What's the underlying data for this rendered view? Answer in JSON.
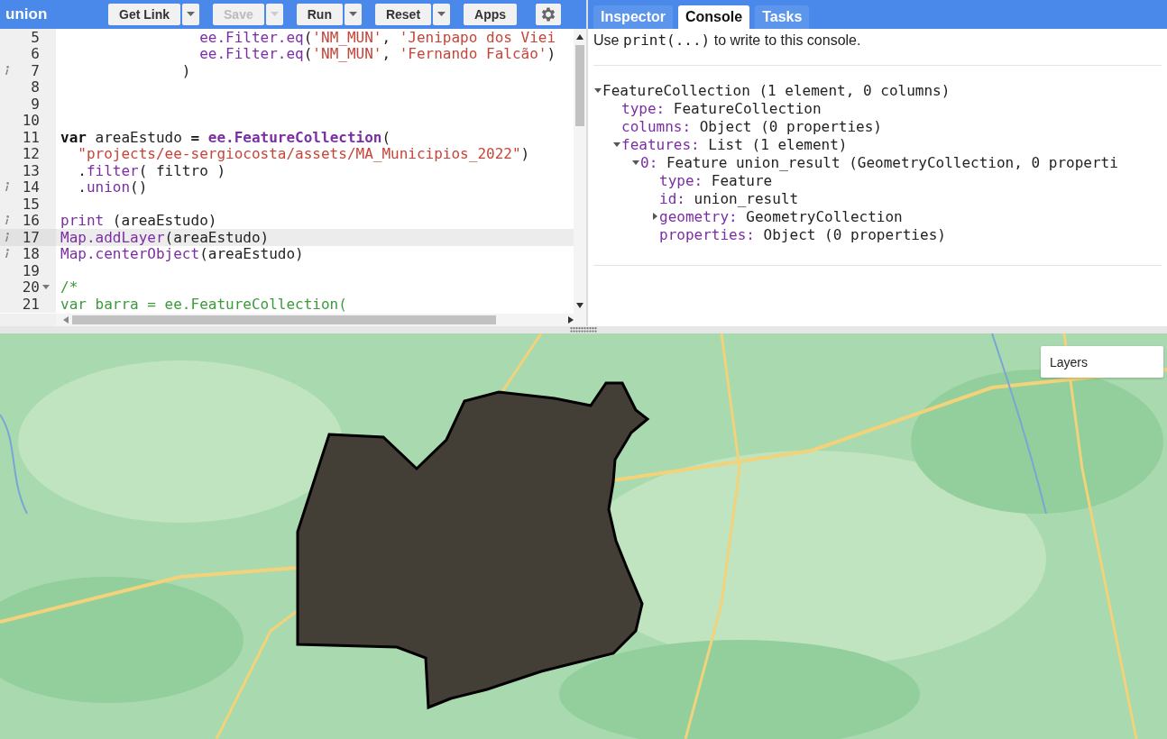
{
  "toolbar": {
    "title": "union",
    "buttons": [
      {
        "label": "Get Link",
        "has_menu": true,
        "disabled": false
      },
      {
        "label": "Save",
        "has_menu": true,
        "disabled": true
      },
      {
        "label": "Run",
        "has_menu": true,
        "disabled": false
      },
      {
        "label": "Reset",
        "has_menu": true,
        "disabled": false
      },
      {
        "label": "Apps",
        "has_menu": false,
        "disabled": false
      }
    ]
  },
  "editor": {
    "lines": [
      {
        "number": "5",
        "info": false,
        "selected": false,
        "fold": false,
        "tokens": [
          {
            "t": "                ee.Filter.eq",
            "kind": "fn"
          },
          {
            "t": "(",
            "kind": "plain"
          },
          {
            "t": "'NM_MUN'",
            "kind": "str"
          },
          {
            "t": ", ",
            "kind": "plain"
          },
          {
            "t": "'Jenipapo dos Viei",
            "kind": "str"
          }
        ]
      },
      {
        "number": "6",
        "info": false,
        "selected": false,
        "fold": false,
        "tokens": [
          {
            "t": "                ee.Filter.eq",
            "kind": "fn"
          },
          {
            "t": "(",
            "kind": "plain"
          },
          {
            "t": "'NM_MUN'",
            "kind": "str"
          },
          {
            "t": ", ",
            "kind": "plain"
          },
          {
            "t": "'Fernando Falcão'",
            "kind": "str"
          },
          {
            "t": ")",
            "kind": "plain"
          }
        ]
      },
      {
        "number": "7",
        "info": true,
        "selected": false,
        "fold": false,
        "tokens": [
          {
            "t": "              )",
            "kind": "plain"
          }
        ]
      },
      {
        "number": "8",
        "info": false,
        "selected": false,
        "fold": false
      },
      {
        "number": "9",
        "info": false,
        "selected": false,
        "fold": false
      },
      {
        "number": "10",
        "info": false,
        "selected": false,
        "fold": false
      },
      {
        "number": "11",
        "info": false,
        "selected": false,
        "fold": false,
        "tokens": [
          {
            "t": "var",
            "kind": "kw"
          },
          {
            "t": " areaEstudo ",
            "kind": "plain"
          },
          {
            "t": "=",
            "kind": "kw"
          },
          {
            "t": " ee.FeatureCollection",
            "kind": "fnb"
          },
          {
            "t": "(",
            "kind": "plain"
          }
        ]
      },
      {
        "number": "12",
        "info": false,
        "selected": false,
        "fold": false,
        "tokens": [
          {
            "t": "  \"projects/ee-sergiocosta/assets/MA_Municipios_2022\"",
            "kind": "str"
          },
          {
            "t": ")",
            "kind": "plain"
          }
        ]
      },
      {
        "number": "13",
        "info": false,
        "selected": false,
        "fold": false,
        "tokens": [
          {
            "t": "  .",
            "kind": "plain"
          },
          {
            "t": "filter",
            "kind": "fn"
          },
          {
            "t": "( filtro )",
            "kind": "plain"
          }
        ]
      },
      {
        "number": "14",
        "info": true,
        "selected": false,
        "fold": false,
        "tokens": [
          {
            "t": "  .",
            "kind": "plain"
          },
          {
            "t": "union",
            "kind": "fn"
          },
          {
            "t": "()",
            "kind": "plain"
          }
        ]
      },
      {
        "number": "15",
        "info": false,
        "selected": false,
        "fold": false
      },
      {
        "number": "16",
        "info": true,
        "selected": false,
        "fold": false,
        "tokens": [
          {
            "t": "print",
            "kind": "fn"
          },
          {
            "t": " (areaEstudo)",
            "kind": "plain"
          }
        ]
      },
      {
        "number": "17",
        "info": true,
        "selected": true,
        "fold": false,
        "tokens": [
          {
            "t": "Map.addLayer",
            "kind": "fn"
          },
          {
            "t": "(areaEstudo)",
            "kind": "plain"
          }
        ]
      },
      {
        "number": "18",
        "info": true,
        "selected": false,
        "fold": false,
        "tokens": [
          {
            "t": "Map.centerObject",
            "kind": "fn"
          },
          {
            "t": "(areaEstudo)",
            "kind": "plain"
          }
        ]
      },
      {
        "number": "19",
        "info": false,
        "selected": false,
        "fold": false
      },
      {
        "number": "20",
        "info": false,
        "selected": false,
        "fold": true,
        "tokens": [
          {
            "t": "/*",
            "kind": "comment"
          }
        ]
      },
      {
        "number": "21",
        "info": false,
        "selected": false,
        "fold": false,
        "tokens": [
          {
            "t": "var barra = ee.FeatureCollection(",
            "kind": "comment"
          }
        ]
      }
    ]
  },
  "tabs": [
    {
      "label": "Inspector",
      "selected": false
    },
    {
      "label": "Console",
      "selected": true
    },
    {
      "label": "Tasks",
      "selected": false
    }
  ],
  "console": {
    "hint_before": "Use ",
    "hint_code": "print(...)",
    "hint_after": " to write to this console.",
    "tree": [
      {
        "value": "FeatureCollection (1 element, 0 columns)",
        "expanded": true,
        "children": [
          {
            "key": "type:",
            "value": "FeatureCollection"
          },
          {
            "key": "columns:",
            "value": "Object (0 properties)"
          },
          {
            "key": "features:",
            "value": "List (1 element)",
            "expanded": true,
            "children": [
              {
                "key": "0:",
                "value": "Feature union_result (GeometryCollection, 0 properti",
                "expanded": true,
                "children": [
                  {
                    "key": "type:",
                    "value": "Feature"
                  },
                  {
                    "key": "id:",
                    "value": "union_result"
                  },
                  {
                    "key": "geometry:",
                    "value": "GeometryCollection",
                    "expanded": false
                  },
                  {
                    "key": "properties:",
                    "value": "Object (0 properties)"
                  }
                ]
              }
            ]
          }
        ]
      }
    ]
  },
  "map": {
    "kind": "picture",
    "layers_button": "Layers"
  }
}
